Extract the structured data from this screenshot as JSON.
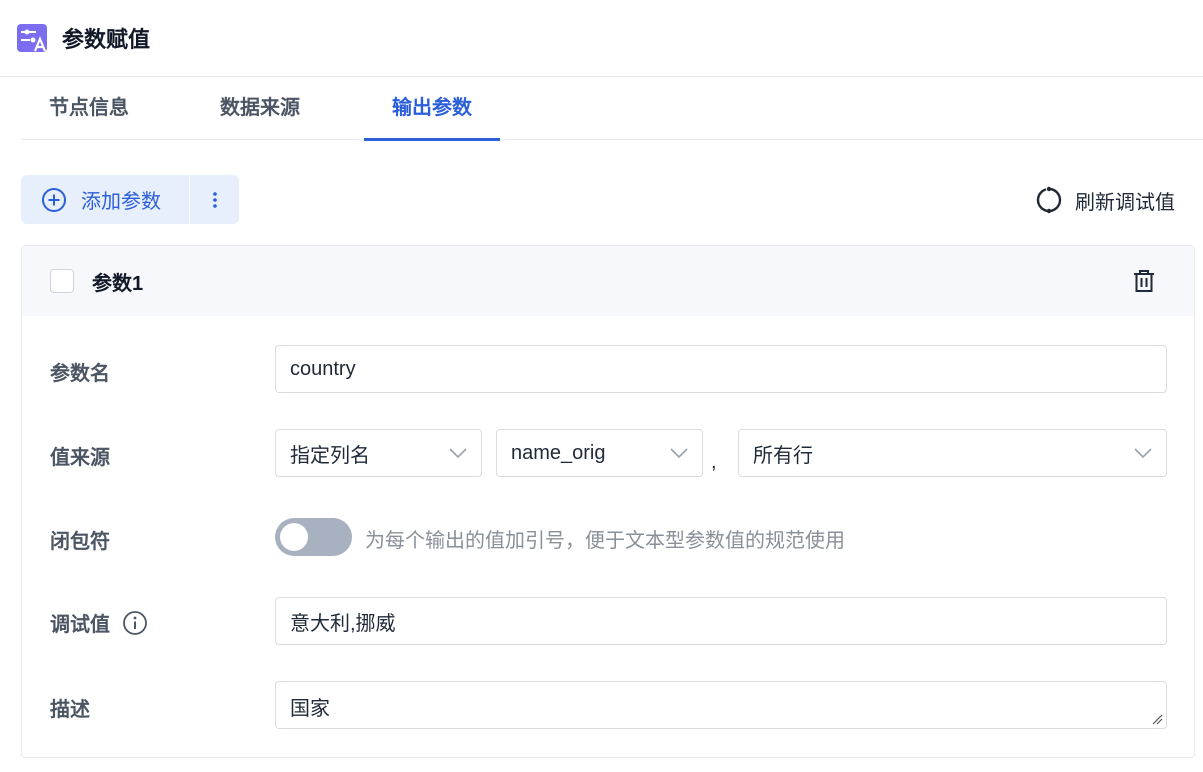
{
  "header": {
    "title": "参数赋值",
    "icon": "parameter-assign-icon"
  },
  "tabs": [
    {
      "label": "节点信息",
      "active": false
    },
    {
      "label": "数据来源",
      "active": false
    },
    {
      "label": "输出参数",
      "active": true
    }
  ],
  "toolbar": {
    "add_label": "添加参数",
    "refresh_label": "刷新调试值"
  },
  "param": {
    "title": "参数1",
    "fields": {
      "name_label": "参数名",
      "name_value": "country",
      "source_label": "值来源",
      "source_type": "指定列名",
      "source_column": "name_orig",
      "comma": ",",
      "source_rows": "所有行",
      "closure_label": "闭包符",
      "closure_enabled": false,
      "closure_hint": "为每个输出的值加引号，便于文本型参数值的规范使用",
      "debug_label": "调试值",
      "debug_value": "意大利,挪威",
      "desc_label": "描述",
      "desc_value": "国家"
    }
  },
  "colors": {
    "accent": "#2b5fd9",
    "accent_bg": "#e8effc",
    "toggle_off": "#a8b1bf"
  }
}
